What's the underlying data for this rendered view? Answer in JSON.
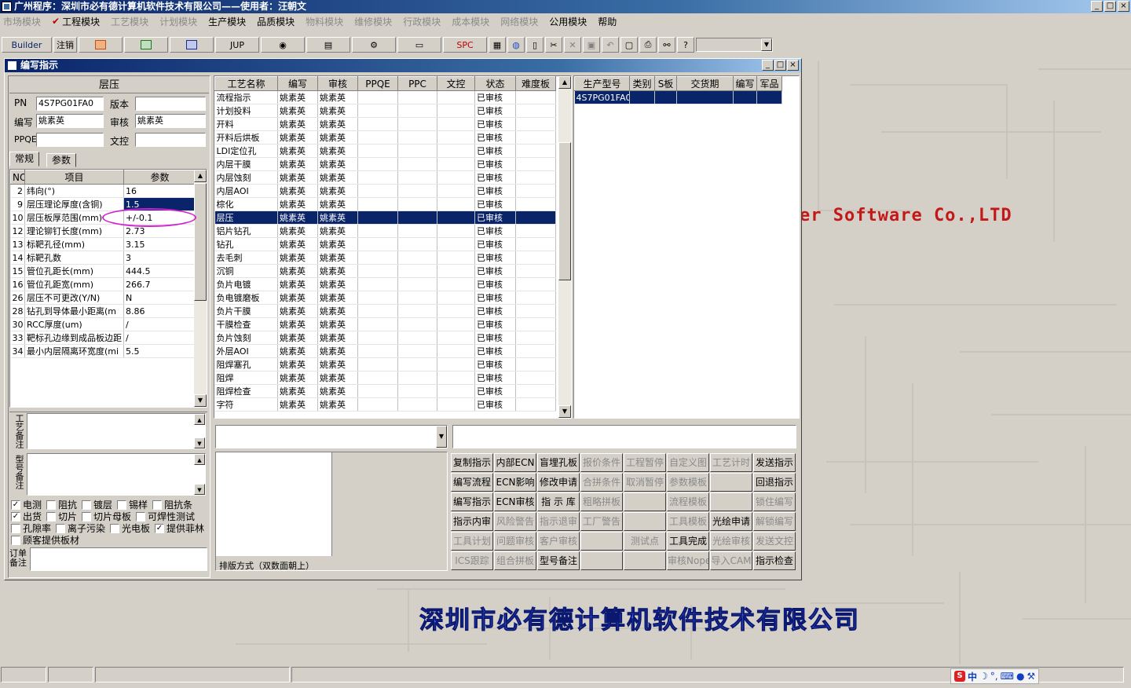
{
  "app": {
    "title": "广州程序：深圳市必有德计算机软件技术有限公司——使用者：汪朝文",
    "window_buttons": [
      "_",
      "□",
      "×"
    ]
  },
  "menu": [
    {
      "label": "市场模块",
      "enabled": false
    },
    {
      "label": "工程模块",
      "enabled": true,
      "checked": true
    },
    {
      "label": "工艺模块",
      "enabled": false
    },
    {
      "label": "计划模块",
      "enabled": false
    },
    {
      "label": "生产模块",
      "enabled": true
    },
    {
      "label": "品质模块",
      "enabled": true
    },
    {
      "label": "物料模块",
      "enabled": false
    },
    {
      "label": "维修模块",
      "enabled": false
    },
    {
      "label": "行政模块",
      "enabled": false
    },
    {
      "label": "成本模块",
      "enabled": false
    },
    {
      "label": "网络模块",
      "enabled": false
    },
    {
      "label": "公用模块",
      "enabled": true
    },
    {
      "label": "帮助",
      "enabled": true
    }
  ],
  "toolbar": {
    "builder": "Builder",
    "logout": "注销",
    "jup": "JUP",
    "spc": "SPC"
  },
  "bg": {
    "software_text": "er Software Co.,LTD",
    "company_text": "深圳市必有德计算机软件技术有限公司"
  },
  "win": {
    "title": "编写指示",
    "header": "层压",
    "pn_label": "PN",
    "pn_value": "4S7PG01FA0",
    "version_label": "版本",
    "version_value": "",
    "writer_label": "编写",
    "writer_value": "姚素英",
    "review_label": "审核",
    "review_value": "姚素英",
    "ppqe_label": "PPQE",
    "ppqe_value": "",
    "doc_label": "文控",
    "doc_value": "",
    "tab_general": "常规",
    "tab_params": "参数"
  },
  "params": {
    "headers": [
      "NO",
      "项目",
      "参数"
    ],
    "rows": [
      [
        "2",
        "纬向(°)",
        "16"
      ],
      [
        "9",
        "层压理论厚度(含铜)",
        "1.5"
      ],
      [
        "10",
        "层压板厚范围(mm)",
        "+/-0.1"
      ],
      [
        "12",
        "理论铆钉长度(mm)",
        "2.73"
      ],
      [
        "13",
        "标靶孔径(mm)",
        "3.15"
      ],
      [
        "14",
        "标靶孔数",
        "3"
      ],
      [
        "15",
        "管位孔距长(mm)",
        "444.5"
      ],
      [
        "16",
        "管位孔距宽(mm)",
        "266.7"
      ],
      [
        "26",
        "层压不可更改(Y/N)",
        "N"
      ],
      [
        "28",
        "钻孔到导体最小距离(m",
        "8.86"
      ],
      [
        "30",
        "RCC厚度(um)",
        "/"
      ],
      [
        "33",
        "靶标孔边缘到成品板边距",
        "/"
      ],
      [
        "34",
        "最小内层隔离环宽度(mi",
        "5.5"
      ]
    ]
  },
  "remarks": {
    "process_label": "工艺备注",
    "model_label": "型号备注",
    "order_label": "订单备注"
  },
  "checks": [
    [
      {
        "label": "电测",
        "checked": true
      },
      {
        "label": "阻抗",
        "checked": false
      },
      {
        "label": "镀层",
        "checked": false
      },
      {
        "label": "锡样",
        "checked": false
      },
      {
        "label": "阻抗条",
        "checked": false
      }
    ],
    [
      {
        "label": "出货",
        "checked": true
      },
      {
        "label": "切片",
        "checked": false
      },
      {
        "label": "切片母板",
        "checked": false
      },
      {
        "label": "可焊性测试",
        "checked": false
      }
    ],
    [
      {
        "label": "孔隙率",
        "checked": false
      },
      {
        "label": "离子污染",
        "checked": false
      },
      {
        "label": "光电板",
        "checked": false
      },
      {
        "label": "提供菲林",
        "checked": true
      }
    ],
    [
      {
        "label": "顾客提供板材",
        "checked": false
      }
    ]
  ],
  "process": {
    "headers": [
      "工艺名称",
      "编写",
      "审核",
      "PPQE",
      "PPC",
      "文控",
      "状态",
      "难度板"
    ],
    "rows": [
      [
        "流程指示",
        "姚素英",
        "姚素英",
        "",
        "",
        "",
        "已审核",
        ""
      ],
      [
        "计划投料",
        "姚素英",
        "姚素英",
        "",
        "",
        "",
        "已审核",
        ""
      ],
      [
        "开料",
        "姚素英",
        "姚素英",
        "",
        "",
        "",
        "已审核",
        ""
      ],
      [
        "开料后烘板",
        "姚素英",
        "姚素英",
        "",
        "",
        "",
        "已审核",
        ""
      ],
      [
        "LDI定位孔",
        "姚素英",
        "姚素英",
        "",
        "",
        "",
        "已审核",
        ""
      ],
      [
        "内层干膜",
        "姚素英",
        "姚素英",
        "",
        "",
        "",
        "已审核",
        ""
      ],
      [
        "内层蚀刻",
        "姚素英",
        "姚素英",
        "",
        "",
        "",
        "已审核",
        ""
      ],
      [
        "内层AOI",
        "姚素英",
        "姚素英",
        "",
        "",
        "",
        "已审核",
        ""
      ],
      [
        "棕化",
        "姚素英",
        "姚素英",
        "",
        "",
        "",
        "已审核",
        ""
      ],
      [
        "层压",
        "姚素英",
        "姚素英",
        "",
        "",
        "",
        "已审核",
        ""
      ],
      [
        "铝片钻孔",
        "姚素英",
        "姚素英",
        "",
        "",
        "",
        "已审核",
        ""
      ],
      [
        "钻孔",
        "姚素英",
        "姚素英",
        "",
        "",
        "",
        "已审核",
        ""
      ],
      [
        "去毛刺",
        "姚素英",
        "姚素英",
        "",
        "",
        "",
        "已审核",
        ""
      ],
      [
        "沉铜",
        "姚素英",
        "姚素英",
        "",
        "",
        "",
        "已审核",
        ""
      ],
      [
        "负片电镀",
        "姚素英",
        "姚素英",
        "",
        "",
        "",
        "已审核",
        ""
      ],
      [
        "负电镀磨板",
        "姚素英",
        "姚素英",
        "",
        "",
        "",
        "已审核",
        ""
      ],
      [
        "负片干膜",
        "姚素英",
        "姚素英",
        "",
        "",
        "",
        "已审核",
        ""
      ],
      [
        "干膜检查",
        "姚素英",
        "姚素英",
        "",
        "",
        "",
        "已审核",
        ""
      ],
      [
        "负片蚀刻",
        "姚素英",
        "姚素英",
        "",
        "",
        "",
        "已审核",
        ""
      ],
      [
        "外层AOI",
        "姚素英",
        "姚素英",
        "",
        "",
        "",
        "已审核",
        ""
      ],
      [
        "阻焊塞孔",
        "姚素英",
        "姚素英",
        "",
        "",
        "",
        "已审核",
        ""
      ],
      [
        "阻焊",
        "姚素英",
        "姚素英",
        "",
        "",
        "",
        "已审核",
        ""
      ],
      [
        "阻焊检查",
        "姚素英",
        "姚素英",
        "",
        "",
        "",
        "已审核",
        ""
      ],
      [
        "字符",
        "姚素英",
        "姚素英",
        "",
        "",
        "",
        "已审核",
        ""
      ]
    ]
  },
  "models": {
    "headers": [
      "生产型号",
      "类别",
      "S板",
      "交货期",
      "编写",
      "军品"
    ],
    "rows": [
      [
        "4S7PG01FA0",
        "",
        "",
        "",
        "",
        ""
      ]
    ]
  },
  "layout_label": "排版方式（双数面朝上）",
  "buttons": [
    [
      "复制指示",
      "内部ECN",
      "盲埋孔板",
      "报价条件",
      "工程暂停",
      "自定义图",
      "工艺计时",
      "发送指示"
    ],
    [
      "编写流程",
      "ECN影响",
      "修改申请",
      "合拼条件",
      "取消暂停",
      "参数模板",
      "",
      "回退指示"
    ],
    [
      "编写指示",
      "ECN审核",
      "指 示 库",
      "粗略拼板",
      "",
      "流程模板",
      "",
      "锁住编写"
    ],
    [
      "指示内审",
      "风险警告",
      "指示退审",
      "工厂警告",
      "",
      "工具模板",
      "光绘申请",
      "解锁编写"
    ],
    [
      "工具计划",
      "问题审核",
      "客户审核",
      "",
      "测试点",
      "工具完成",
      "光绘审核",
      "发送文控"
    ],
    [
      "ICS跟踪",
      "组合拼板",
      "型号备注",
      "",
      "",
      "审核Nope",
      "导入CAM",
      "指示检查"
    ]
  ],
  "buttons_enabled": [
    [
      true,
      true,
      true,
      false,
      false,
      false,
      false,
      true
    ],
    [
      true,
      true,
      true,
      false,
      false,
      false,
      false,
      true
    ],
    [
      true,
      true,
      true,
      false,
      false,
      false,
      false,
      false
    ],
    [
      true,
      false,
      false,
      false,
      false,
      false,
      true,
      false
    ],
    [
      false,
      false,
      false,
      false,
      false,
      true,
      false,
      false
    ],
    [
      false,
      false,
      true,
      false,
      false,
      false,
      false,
      true
    ]
  ],
  "ime": {
    "label": "中"
  }
}
